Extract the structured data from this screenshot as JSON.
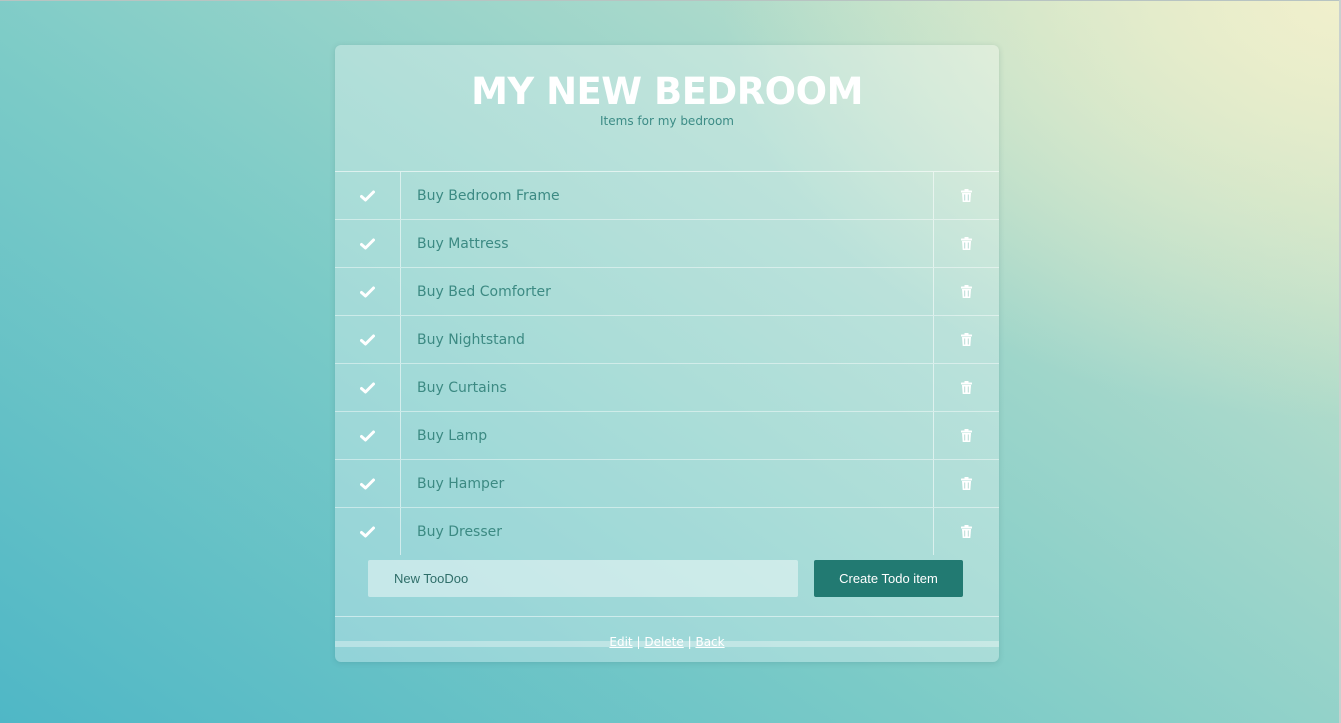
{
  "header": {
    "title": "MY NEW BEDROOM",
    "subtitle": "Items for my bedroom"
  },
  "icons": {
    "complete": "check-icon",
    "remove": "trash-icon"
  },
  "items": [
    {
      "label": "Buy Bedroom Frame"
    },
    {
      "label": "Buy Mattress"
    },
    {
      "label": "Buy Bed Comforter"
    },
    {
      "label": "Buy Nightstand"
    },
    {
      "label": "Buy Curtains"
    },
    {
      "label": "Buy Lamp"
    },
    {
      "label": "Buy Hamper"
    },
    {
      "label": "Buy Dresser"
    }
  ],
  "form": {
    "placeholder": "New TooDoo",
    "button_label": "Create Todo item"
  },
  "footer": {
    "edit": "Edit",
    "delete": "Delete",
    "back": "Back",
    "separator": "|"
  },
  "colors": {
    "accent": "#227a72",
    "item_text": "#3c8a83",
    "title": "#ffffff"
  }
}
